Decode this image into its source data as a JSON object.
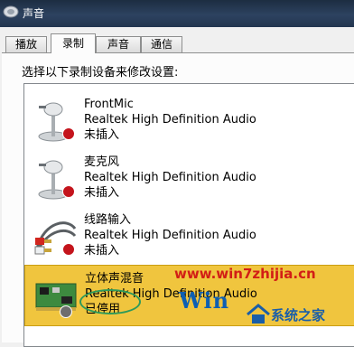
{
  "window": {
    "title": "声音"
  },
  "tabs": [
    {
      "label": "播放"
    },
    {
      "label": "录制"
    },
    {
      "label": "声音"
    },
    {
      "label": "通信"
    }
  ],
  "main": {
    "instruction": "选择以下录制设备来修改设置:"
  },
  "devices": [
    {
      "name": "FrontMic",
      "driver": "Realtek High Definition Audio",
      "status": "未插入",
      "icon": "microphone-icon"
    },
    {
      "name": "麦克风",
      "driver": "Realtek High Definition Audio",
      "status": "未插入",
      "icon": "microphone-icon"
    },
    {
      "name": "线路输入",
      "driver": "Realtek High Definition Audio",
      "status": "未插入",
      "icon": "line-in-cable-icon"
    },
    {
      "name": "立体声混音",
      "driver": "Realtek High Definition Audio",
      "status": "已停用",
      "icon": "sound-card-icon"
    }
  ],
  "watermark": {
    "url": "www.win7zhijia.cn",
    "brand": "Win",
    "site": "系统之家"
  },
  "colors": {
    "titlebar": "#2d4260",
    "selected_row": "#f0c53e",
    "status_badge": "#c4141c",
    "annotation_ellipse": "#2e9a5a",
    "watermark_red": "#d21e16",
    "watermark_blue": "#0e5fb3"
  }
}
